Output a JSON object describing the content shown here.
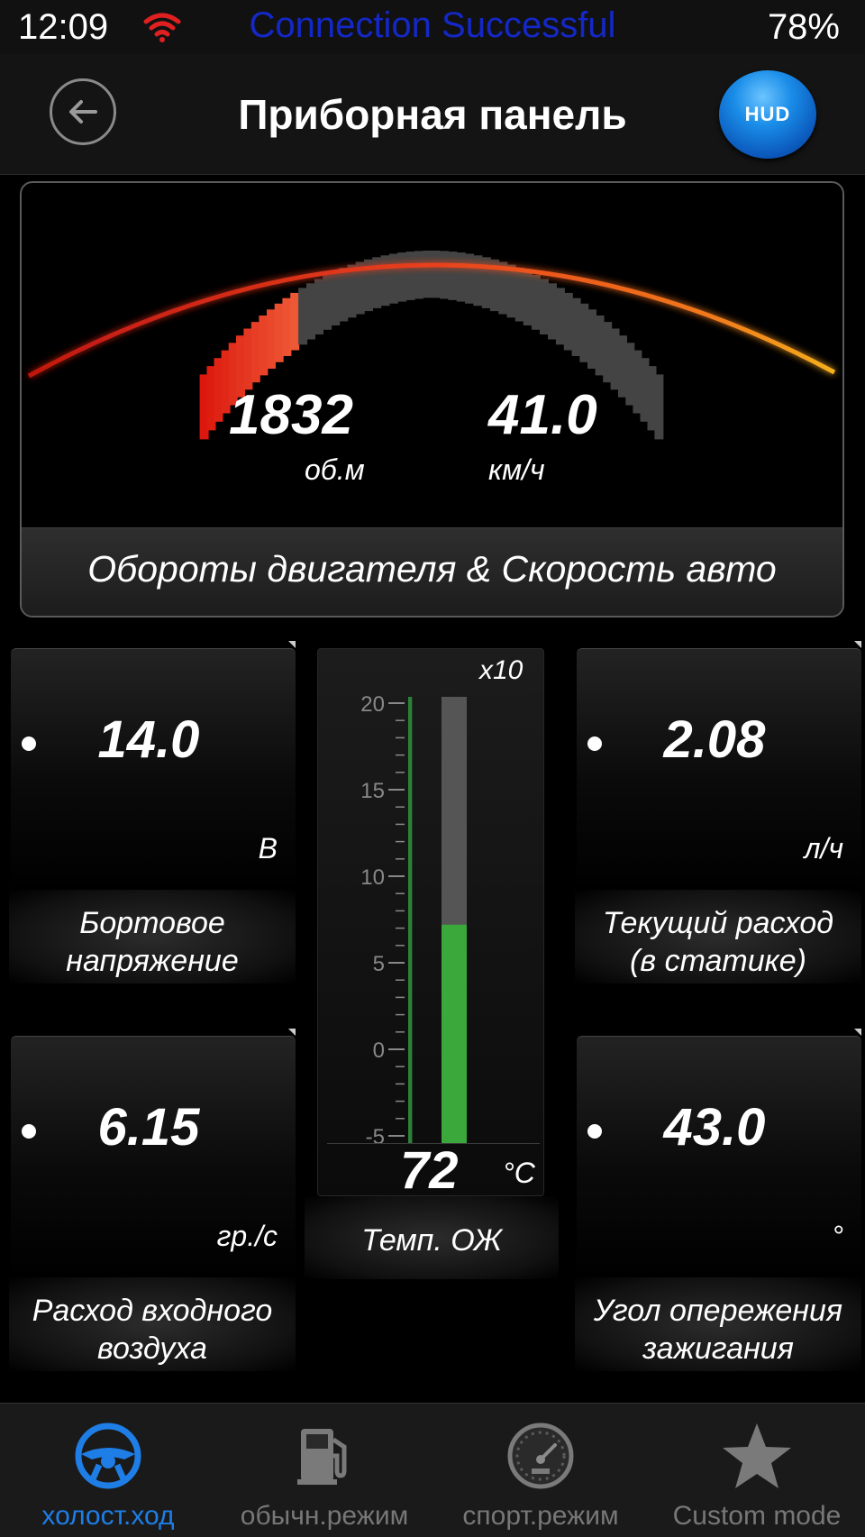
{
  "status_bar": {
    "time": "12:09",
    "message": "Connection Successful",
    "battery": "78%",
    "wifi_color": "#e02020",
    "message_color": "#1428c8"
  },
  "header": {
    "title": "Приборная панель",
    "back_icon": "arrow-left-icon",
    "hud_label": "HUD"
  },
  "main_gauge": {
    "rpm": "1832",
    "rpm_unit": "об.м",
    "speed": "41.0",
    "speed_unit": "км/ч",
    "label": "Обороты двигателя & Скорость авто",
    "rpm_fraction": 0.23,
    "active_color": "#e8281e",
    "inactive_color": "#444444"
  },
  "tiles": {
    "voltage": {
      "value": "14.0",
      "unit": "В",
      "label_line1": "Бортовое",
      "label_line2": "напряжение"
    },
    "fuel": {
      "value": "2.08",
      "unit": "л/ч",
      "label_line1": "Текущий расход",
      "label_line2": "(в статике)"
    },
    "air": {
      "value": "6.15",
      "unit": "гр./с",
      "label_line1": "Расход входного",
      "label_line2": "воздуха"
    },
    "timing": {
      "value": "43.0",
      "unit": "°",
      "label_line1": "Угол опережения",
      "label_line2": "зажигания"
    }
  },
  "thermometer": {
    "multiplier": "x10",
    "value": "72",
    "unit": "°C",
    "label": "Темп. ОЖ",
    "scale_ticks": [
      "20",
      "15",
      "10",
      "5",
      "0",
      "-5"
    ],
    "scale_min": -5,
    "scale_max": 20,
    "level": 7.2,
    "fill_color": "#3aa83a"
  },
  "tabs": [
    {
      "label": "холост.ход",
      "icon": "steering-wheel-icon",
      "active": true
    },
    {
      "label": "обычн.режим",
      "icon": "fuel-pump-icon",
      "active": false
    },
    {
      "label": "спорт.режим",
      "icon": "speedometer-icon",
      "active": false
    },
    {
      "label": "Custom mode",
      "icon": "star-icon",
      "active": false
    }
  ]
}
